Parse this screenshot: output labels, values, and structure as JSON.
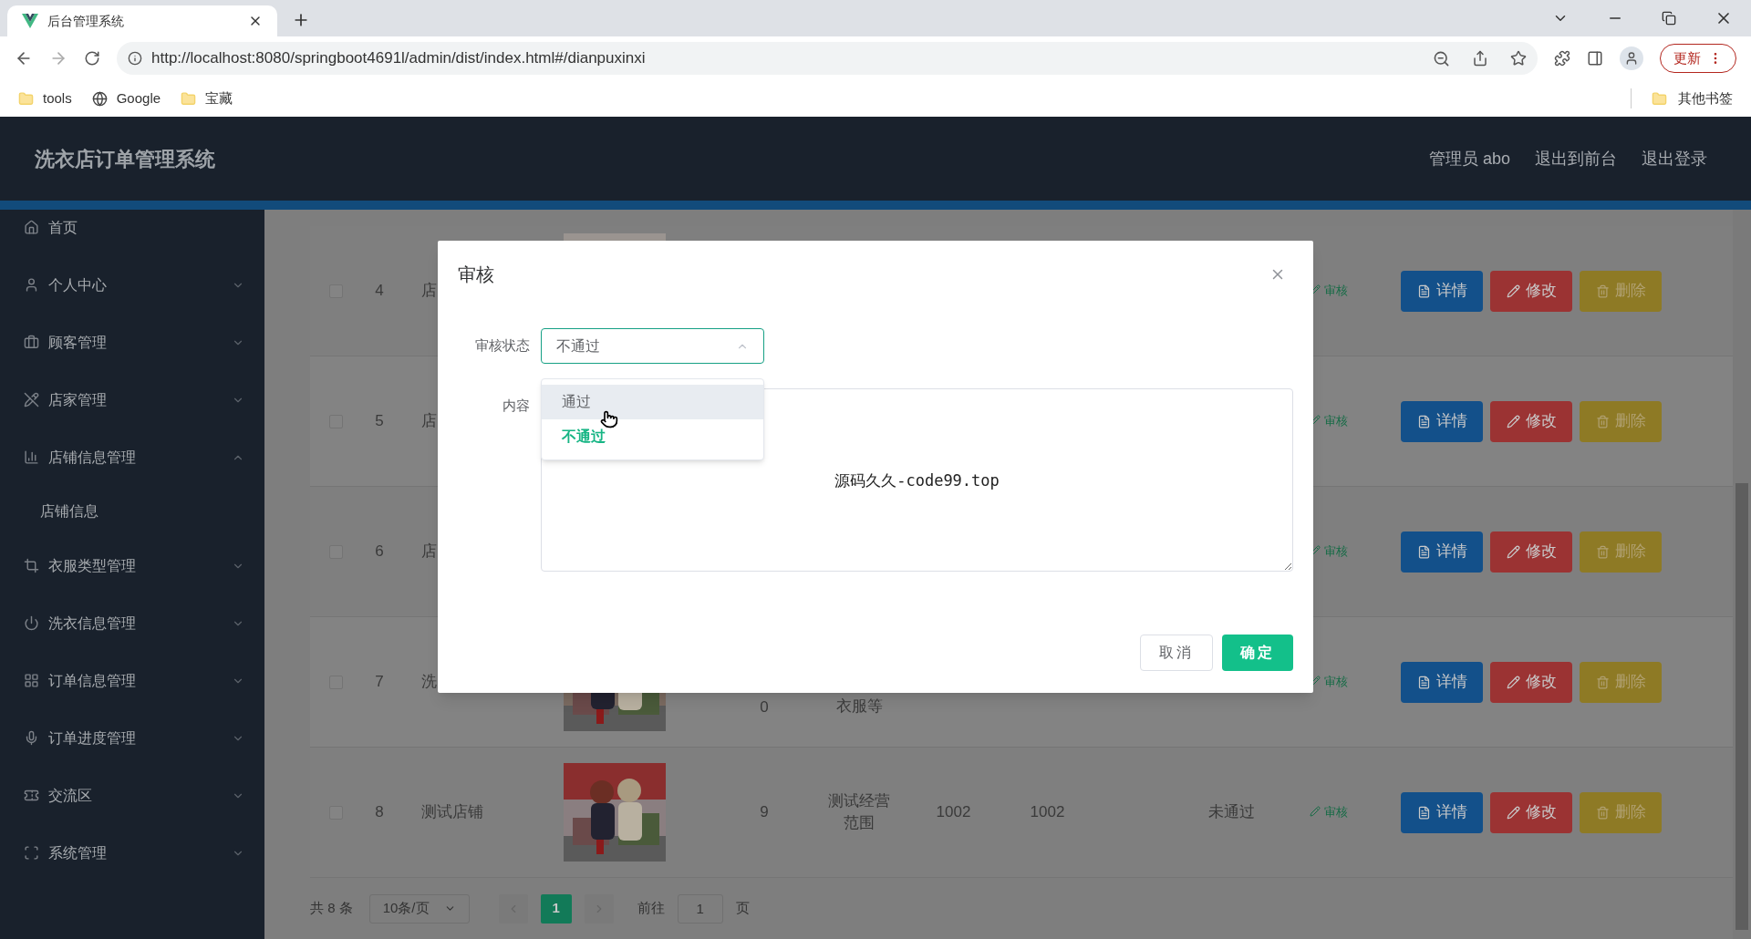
{
  "browser": {
    "tab_title": "后台管理系统",
    "url": "http://localhost:8080/springboot4691l/admin/dist/index.html#/dianpuxinxi",
    "update_button": "更新",
    "bookmarks": [
      {
        "label": "tools",
        "kind": "folder"
      },
      {
        "label": "Google",
        "kind": "site"
      },
      {
        "label": "宝藏",
        "kind": "folder"
      }
    ],
    "other_bookmarks": "其他书签"
  },
  "header": {
    "title": "洗衣店订单管理系统",
    "links": [
      "管理员 abo",
      "退出到前台",
      "退出登录"
    ]
  },
  "sidebar": {
    "items": [
      {
        "label": "首页",
        "kind": "link"
      },
      {
        "label": "个人中心",
        "kind": "submenu",
        "expanded": false
      },
      {
        "label": "顾客管理",
        "kind": "submenu",
        "expanded": false
      },
      {
        "label": "店家管理",
        "kind": "submenu",
        "expanded": false
      },
      {
        "label": "店铺信息管理",
        "kind": "submenu",
        "expanded": true,
        "children": [
          {
            "label": "店铺信息"
          }
        ]
      },
      {
        "label": "衣服类型管理",
        "kind": "submenu",
        "expanded": false
      },
      {
        "label": "洗衣信息管理",
        "kind": "submenu",
        "expanded": false
      },
      {
        "label": "订单信息管理",
        "kind": "submenu",
        "expanded": false
      },
      {
        "label": "订单进度管理",
        "kind": "submenu",
        "expanded": false
      },
      {
        "label": "交流区",
        "kind": "submenu",
        "expanded": false
      },
      {
        "label": "系统管理",
        "kind": "submenu",
        "expanded": false
      }
    ]
  },
  "table": {
    "rows": [
      {
        "checked": false,
        "index": "4",
        "name": "店",
        "audit_link": "审核",
        "actions": [
          "详情",
          "修改",
          "删除"
        ]
      },
      {
        "checked": false,
        "index": "5",
        "name": "店",
        "audit_link": "审核",
        "actions": [
          "详情",
          "修改",
          "删除"
        ]
      },
      {
        "checked": false,
        "index": "6",
        "name": "店",
        "audit_link": "审核",
        "actions": [
          "详情",
          "修改",
          "删除"
        ]
      },
      {
        "checked": false,
        "index": "7",
        "name": "洗",
        "price": "0",
        "scope": "衣服等",
        "audit_link": "审核",
        "actions": [
          "详情",
          "修改",
          "删除"
        ]
      },
      {
        "checked": false,
        "index": "8",
        "name": "测试店铺",
        "price": "9",
        "scope": "测试经营范围",
        "column_7": "1002",
        "column_8": "1002",
        "status": "未通过",
        "audit_link": "审核",
        "actions": [
          "详情",
          "修改",
          "删除"
        ]
      }
    ]
  },
  "pagination": {
    "total": "共 8 条",
    "page_size": "10条/页",
    "pages": [
      {
        "label": "1",
        "selected": true
      }
    ],
    "goto_label": "前往",
    "goto_value": "1",
    "page_suffix": "页"
  },
  "dialog": {
    "title": "审核",
    "fields": [
      {
        "label": "审核状态",
        "kind": "select",
        "value": "不通过",
        "open": true,
        "options": [
          {
            "label": "通过",
            "selected": false,
            "hovered": true
          },
          {
            "label": "不通过",
            "selected": true,
            "hovered": false
          }
        ]
      },
      {
        "label": "内容",
        "kind": "textarea",
        "value": "源码久久-code99.top"
      }
    ],
    "buttons": [
      {
        "label": "取消",
        "kind": "secondary"
      },
      {
        "label": "确定",
        "kind": "primary"
      }
    ]
  }
}
